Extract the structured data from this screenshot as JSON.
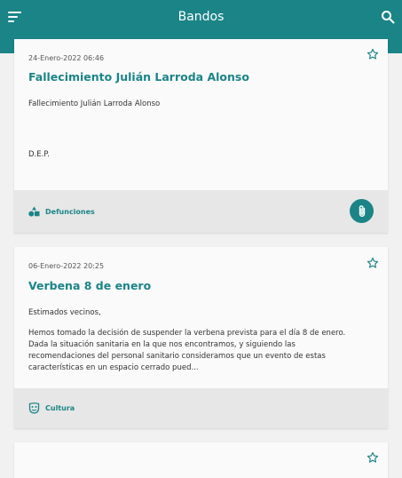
{
  "header": {
    "title": "Bandos",
    "icons": {
      "menu": "menu-icon",
      "search": "search-icon"
    }
  },
  "cards": [
    {
      "date": "24-Enero-2022 06:46",
      "title": "Fallecimiento Julián Larroda Alonso",
      "paragraphs": [
        "Fallecimiento Julián Larroda Alonso",
        "D.E.P."
      ],
      "category": "Defunciones",
      "category_icon": "shapes-icon",
      "has_attachment": true
    },
    {
      "date": "06-Enero-2022 20:25",
      "title": "Verbena 8 de enero",
      "paragraphs": [
        "Estimados vecinos,",
        "Hemos tomado la decisión de suspender la verbena prevista para el día 8 de enero. Dada la situación sanitaria en la que nos encontramos, y siguiendo las recomendaciones del personal sanitario consideramos que un evento de estas características en un espacio cerrado pued..."
      ],
      "category": "Cultura",
      "category_icon": "theater-masks-icon",
      "has_attachment": false
    }
  ],
  "colors": {
    "accent": "#1b8487",
    "card": "#fafafa",
    "footer": "#e7e7e7",
    "background": "#f1f1f1"
  }
}
